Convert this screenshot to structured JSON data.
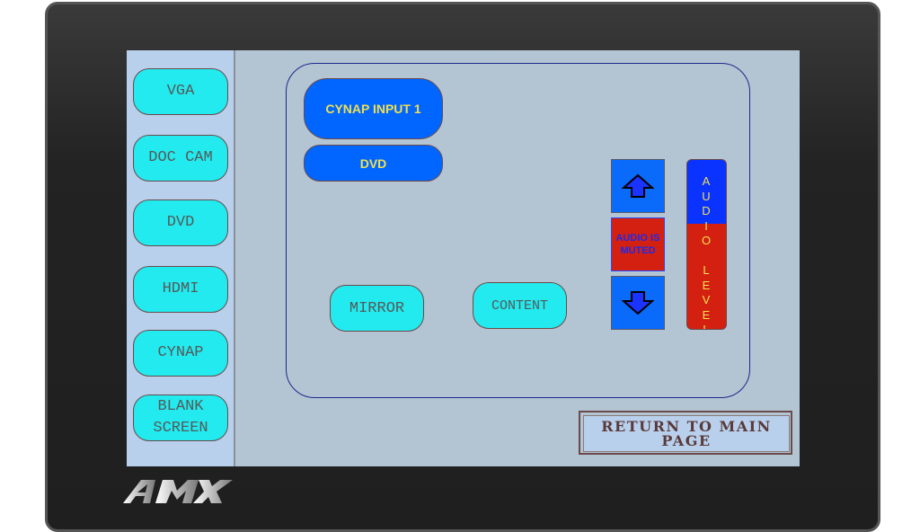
{
  "brand": {
    "logo_text": "AMX"
  },
  "sidebar": {
    "items": [
      {
        "label": "VGA"
      },
      {
        "label": "DOC CAM"
      },
      {
        "label": "DVD"
      },
      {
        "label": "HDMI"
      },
      {
        "label": "CYNAP"
      },
      {
        "label": "BLANK SCREEN"
      }
    ]
  },
  "main": {
    "source_title": "CYNAP INPUT 1",
    "source_sub": "DVD",
    "mirror_label": "MIRROR",
    "content_label": "CONTENT"
  },
  "audio": {
    "up_icon": "arrow-up-icon",
    "down_icon": "arrow-down-icon",
    "mute_status": "AUDIO IS MUTED",
    "level_label": "AUDIO\nLEVEL",
    "level_fraction": 0.62,
    "colors": {
      "level_fill": "#d42010",
      "level_empty": "#0a33ff"
    }
  },
  "footer": {
    "return_label": "RETURN TO MAIN PAGE"
  },
  "colors": {
    "source_button": "#22eaee",
    "active_button": "#0066ff",
    "button_text": "#f0e050"
  }
}
